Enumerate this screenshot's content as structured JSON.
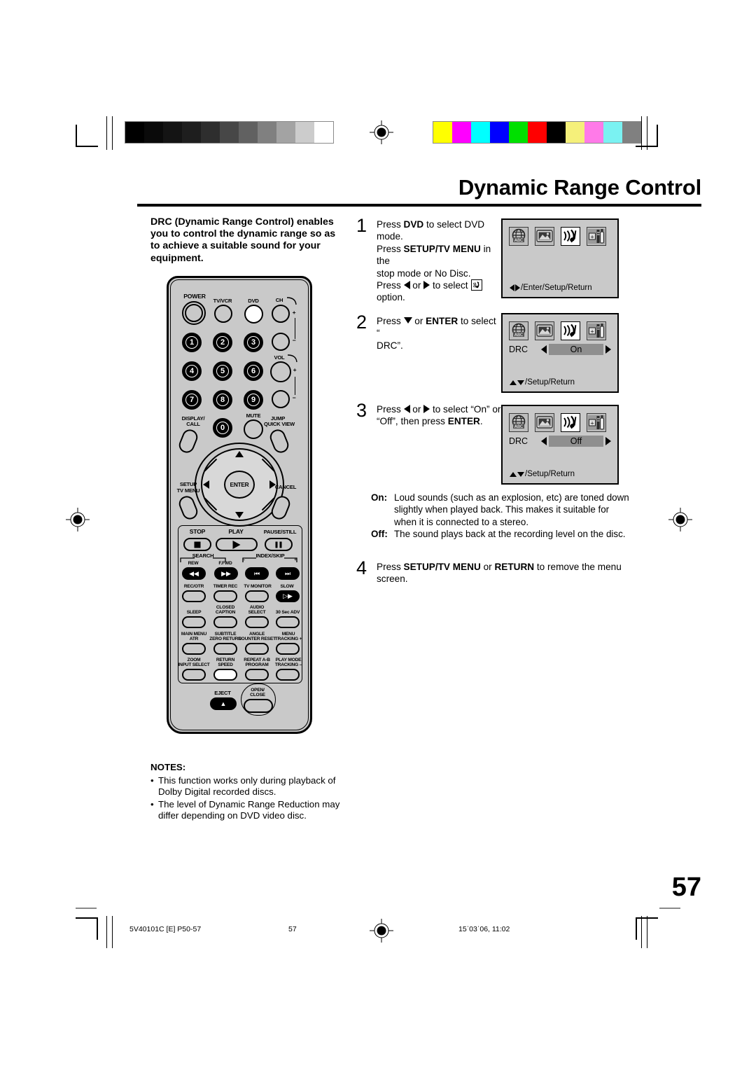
{
  "page": {
    "title": "Dynamic Range Control",
    "number": "57"
  },
  "intro": {
    "text": "DRC (Dynamic Range Control) enables you to control the dynamic range so as to achieve a suitable sound for your equipment."
  },
  "steps": [
    {
      "num": "1",
      "line1_a": "Press ",
      "line1_b": "DVD",
      "line1_c": " to select DVD mode.",
      "line2_a": "Press ",
      "line2_b": "SETUP/TV MENU",
      "line2_c": " in the",
      "line3": "stop mode or No Disc.",
      "line4_a": "Press ",
      "line4_b": " or ",
      "line4_c": " to select ",
      "line5": "option."
    },
    {
      "num": "2",
      "line1_a": "Press ",
      "line1_b": " or ",
      "line1_c": "ENTER",
      "line1_d": " to select “",
      "line2": "DRC”."
    },
    {
      "num": "3",
      "line1_a": "Press ",
      "line1_b": " or ",
      "line1_c": " to select “On” or",
      "line2_a": "“Off”, then press ",
      "line2_b": "ENTER",
      "line2_c": "."
    },
    {
      "num": "4",
      "line1_a": "Press ",
      "line1_b": "SETUP/TV MENU",
      "line1_c": " or ",
      "line1_d": "RETURN",
      "line1_e": " to remove the menu",
      "line2": "screen."
    }
  ],
  "osd_panels": [
    {
      "name": "setup-top-menu",
      "icons": [
        "language-globe-icon",
        "picture-display-icon",
        "audio-speaker-icon",
        "others-tools-icon"
      ],
      "selected_index": 2,
      "row_label": "",
      "row_value": "",
      "has_row": false,
      "footer": "/Enter/Setup/Return",
      "footer_arrows": "lr"
    },
    {
      "name": "drc-on-menu",
      "icons": [
        "language-globe-icon",
        "picture-display-icon",
        "audio-speaker-icon",
        "others-tools-icon"
      ],
      "selected_index": 2,
      "row_label": "DRC",
      "row_value": "On",
      "has_row": true,
      "footer": "/Setup/Return",
      "footer_arrows": "ud"
    },
    {
      "name": "drc-off-menu",
      "icons": [
        "language-globe-icon",
        "picture-display-icon",
        "audio-speaker-icon",
        "others-tools-icon"
      ],
      "selected_index": 2,
      "row_label": "DRC",
      "row_value": "Off",
      "has_row": true,
      "footer": "/Setup/Return",
      "footer_arrows": "ud"
    }
  ],
  "onoff": [
    {
      "key": "On:",
      "lines": [
        "Loud sounds (such as an explosion, etc) are toned down",
        "slightly when played back. This makes it suitable for",
        "when it is connected to a stereo."
      ]
    },
    {
      "key": "Off:",
      "lines": [
        "The sound plays back at the recording level on the disc."
      ]
    }
  ],
  "notes": {
    "heading": "NOTES:",
    "items": [
      "This function works only during playback of Dolby Digital recorded discs.",
      "The level of Dynamic Range Reduction may differ depending on DVD video disc."
    ],
    "bullet": "•"
  },
  "footer": {
    "left": "5V40101C [E] P50-57",
    "center": "57",
    "right": "15ˈ03ˈ06, 11:02"
  },
  "colorbars": {
    "gray": [
      "#000000",
      "#0a0a0a",
      "#141414",
      "#1e1e1e",
      "#2e2e2e",
      "#474747",
      "#616161",
      "#808080",
      "#a3a3a3",
      "#cccccc",
      "#ffffff"
    ],
    "color": [
      "#ffff00",
      "#ff00ff",
      "#00ffff",
      "#0000ff",
      "#00e000",
      "#ff0000",
      "#000000",
      "#f5f07a",
      "#ff7ae8",
      "#7 af2f2",
      "#808080"
    ]
  },
  "remote": {
    "name": "dvd-vcr-remote-control",
    "top_buttons": [
      {
        "label": "POWER",
        "style": "power"
      },
      {
        "label": "TV/VCR",
        "style": "plain"
      },
      {
        "label": "DVD",
        "style": "white"
      },
      {
        "label": "CH",
        "style": "chvol"
      }
    ],
    "number_keys": [
      "1",
      "2",
      "3",
      "4",
      "5",
      "6",
      "7",
      "8",
      "9",
      "0"
    ],
    "ch_label": "CH",
    "vol_label": "VOL",
    "plus": "+",
    "minus": "−",
    "mute_label": "MUTE",
    "display_call_label": "DISPLAY/\nCALL",
    "display_call_l1": "DISPLAY/",
    "display_call_l2": "CALL",
    "jump_l1": "JUMP",
    "jump_l2": "QUICK VIEW",
    "setup_l1": "SETUP",
    "setup_l2": "TV MENU",
    "cancel_label": "CANCEL",
    "enter_label": "ENTER",
    "transport": {
      "stop": "STOP",
      "play": "PLAY",
      "pause": "PAUSE/STILL",
      "search": "SEARCH",
      "rew": "REW",
      "ffwd": "F.FWD",
      "index_skip": "INDEX/SKIP",
      "index_minus": "–",
      "index_plus": "+"
    },
    "fn_rows": [
      [
        {
          "l1": "REC/OTR",
          "l2": ""
        },
        {
          "l1": "TIMER REC",
          "l2": ""
        },
        {
          "l1": "TV MONITOR",
          "l2": ""
        },
        {
          "l1": "SLOW",
          "l2": ""
        }
      ],
      [
        {
          "l1": "SLEEP",
          "l2": ""
        },
        {
          "l1": "CLOSED",
          "l2": "CAPTION"
        },
        {
          "l1": "AUDIO",
          "l2": "SELECT"
        },
        {
          "l1": "30 Sec ADV",
          "l2": ""
        }
      ],
      [
        {
          "l1": "MAIN MENU",
          "l2": "ATR"
        },
        {
          "l1": "SUBTITLE",
          "l2": "ZERO RETURN"
        },
        {
          "l1": "ANGLE",
          "l2": "COUNTER RESET"
        },
        {
          "l1": "MENU",
          "l2": "TRACKING +"
        }
      ],
      [
        {
          "l1": "ZOOM",
          "l2": "INPUT SELECT"
        },
        {
          "l1": "RETURN",
          "l2": "SPEED"
        },
        {
          "l1": "REPEAT A-B",
          "l2": "PROGRAM"
        },
        {
          "l1": "PLAY MODE",
          "l2": "TRACKING –"
        }
      ]
    ],
    "eject_label": "EJECT",
    "openclose_l1": "OPEN/",
    "openclose_l2": "CLOSE"
  }
}
